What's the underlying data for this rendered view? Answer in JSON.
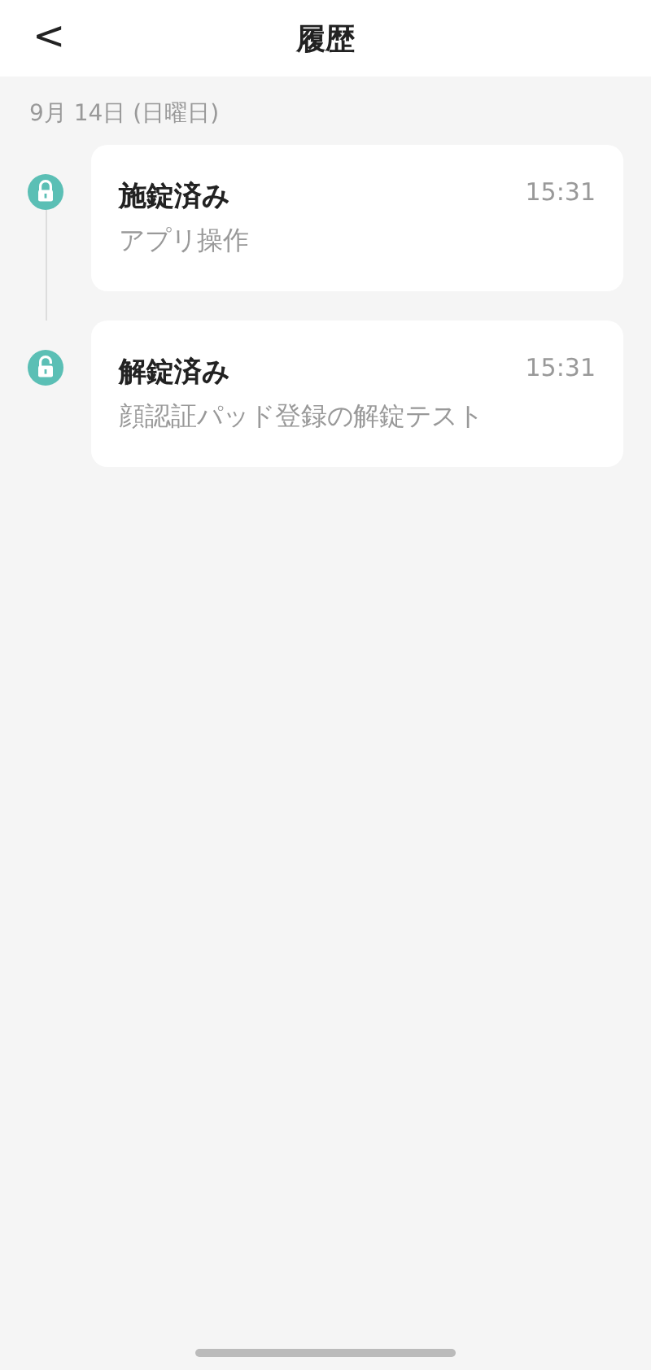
{
  "header": {
    "back": "<",
    "title": "履歴"
  },
  "date": "9月 14日 (日曜日)",
  "events": [
    {
      "kind": "locked",
      "title": "施錠済み",
      "description": "アプリ操作",
      "time": "15:31"
    },
    {
      "kind": "unlocked",
      "title": "解錠済み",
      "description": "顔認証パッド登録の解錠テスト",
      "time": "15:31"
    }
  ]
}
